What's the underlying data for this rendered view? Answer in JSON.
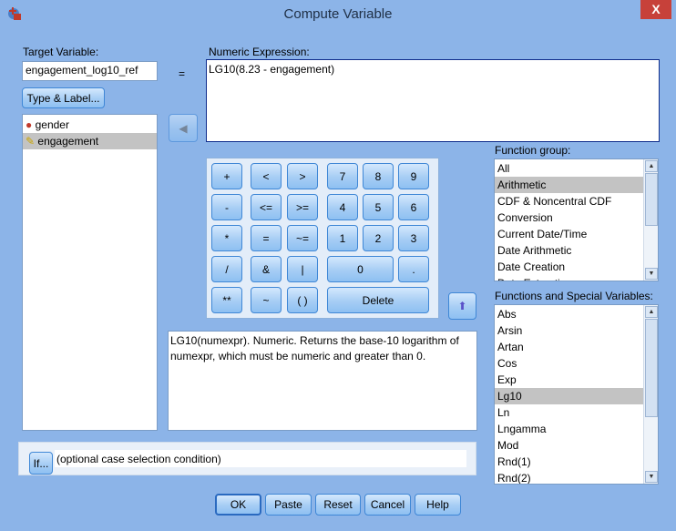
{
  "window": {
    "title": "Compute Variable",
    "close": "X"
  },
  "target": {
    "label": "Target Variable:",
    "value": "engagement_log10_ref",
    "type_label_button": "Type & Label..."
  },
  "equals": "=",
  "variables": [
    {
      "name": "gender",
      "icon": "nominal-icon"
    },
    {
      "name": "engagement",
      "icon": "scale-ruler-icon",
      "selected": true
    }
  ],
  "expression": {
    "label": "Numeric Expression:",
    "value": "LG10(8.23 - engagement)"
  },
  "keypad": {
    "keys": [
      "+",
      "<",
      ">",
      "7",
      "8",
      "9",
      "-",
      "<=",
      ">=",
      "4",
      "5",
      "6",
      "*",
      "=",
      "~=",
      "1",
      "2",
      "3",
      "/",
      "&",
      "|",
      "0",
      ".",
      "**",
      "~",
      "( )",
      "Delete"
    ]
  },
  "description": "LG10(numexpr). Numeric. Returns the base-10 logarithm of numexpr, which must be numeric and greater than 0.",
  "function_group": {
    "label": "Function group:",
    "items": [
      "All",
      "Arithmetic",
      "CDF & Noncentral CDF",
      "Conversion",
      "Current Date/Time",
      "Date Arithmetic",
      "Date Creation",
      "Date Extraction"
    ],
    "selected": "Arithmetic"
  },
  "functions": {
    "label": "Functions and Special Variables:",
    "items": [
      "Abs",
      "Arsin",
      "Artan",
      "Cos",
      "Exp",
      "Lg10",
      "Ln",
      "Lngamma",
      "Mod",
      "Rnd(1)",
      "Rnd(2)"
    ],
    "selected": "Lg10"
  },
  "if": {
    "button": "If...",
    "text": "(optional case selection condition)"
  },
  "buttons": {
    "ok": "OK",
    "paste": "Paste",
    "reset": "Reset",
    "cancel": "Cancel",
    "help": "Help"
  }
}
